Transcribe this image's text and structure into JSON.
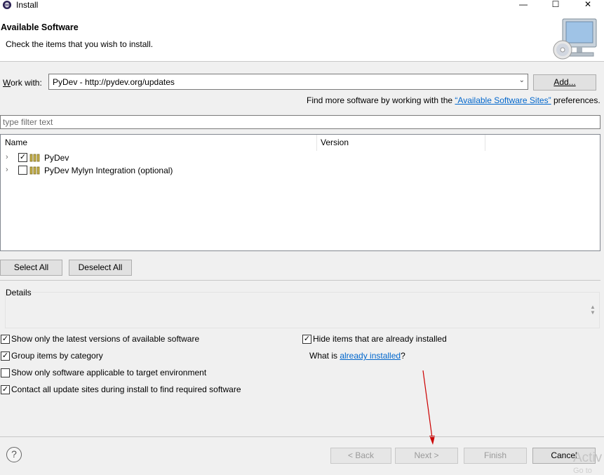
{
  "window": {
    "title": "Install",
    "minimize_glyph": "—",
    "maximize_glyph": "☐",
    "close_glyph": "✕"
  },
  "banner": {
    "title": "Available Software",
    "description": "Check the items that you wish to install."
  },
  "work_with": {
    "label_accel": "W",
    "label_rest": "ork with:",
    "value": "PyDev - http://pydev.org/updates",
    "add_button": "Add..."
  },
  "find_more": {
    "prefix": "Find more software by working with the ",
    "link": "“Available Software Sites”",
    "suffix": " preferences."
  },
  "filter": {
    "placeholder": "type filter text"
  },
  "tree": {
    "columns": [
      "Name",
      "Version"
    ],
    "rows": [
      {
        "label": "PyDev",
        "checked": true
      },
      {
        "label": "PyDev Mylyn Integration (optional)",
        "checked": false
      }
    ]
  },
  "buttons": {
    "select_all": "Select All",
    "deselect_all": "Deselect All"
  },
  "details": {
    "label": "Details"
  },
  "options": {
    "show_latest": {
      "label": "Show only the latest versions of available software",
      "checked": true
    },
    "group_by_category": {
      "label": "Group items by category",
      "checked": true
    },
    "applicable_only": {
      "label": "Show only software applicable to target environment",
      "checked": false
    },
    "contact_sites": {
      "label": "Contact all update sites during install to find required software",
      "checked": true
    },
    "hide_installed": {
      "label": "Hide items that are already installed",
      "checked": true
    }
  },
  "what_is": {
    "prefix": "What is ",
    "link": "already installed",
    "suffix": "?"
  },
  "nav": {
    "back": "< Back",
    "next": "Next >",
    "finish": "Finish",
    "cancel": "Cancel"
  },
  "watermark": {
    "line1": "Activ",
    "line2": "Go to"
  },
  "colors": {
    "link": "#0066cc",
    "annotation_arrow": "#cc0000"
  },
  "icons": {
    "app": "eclipse-icon",
    "banner": "monitor-cd-icon",
    "package": "plugin-package-icon",
    "help": "help-icon"
  }
}
